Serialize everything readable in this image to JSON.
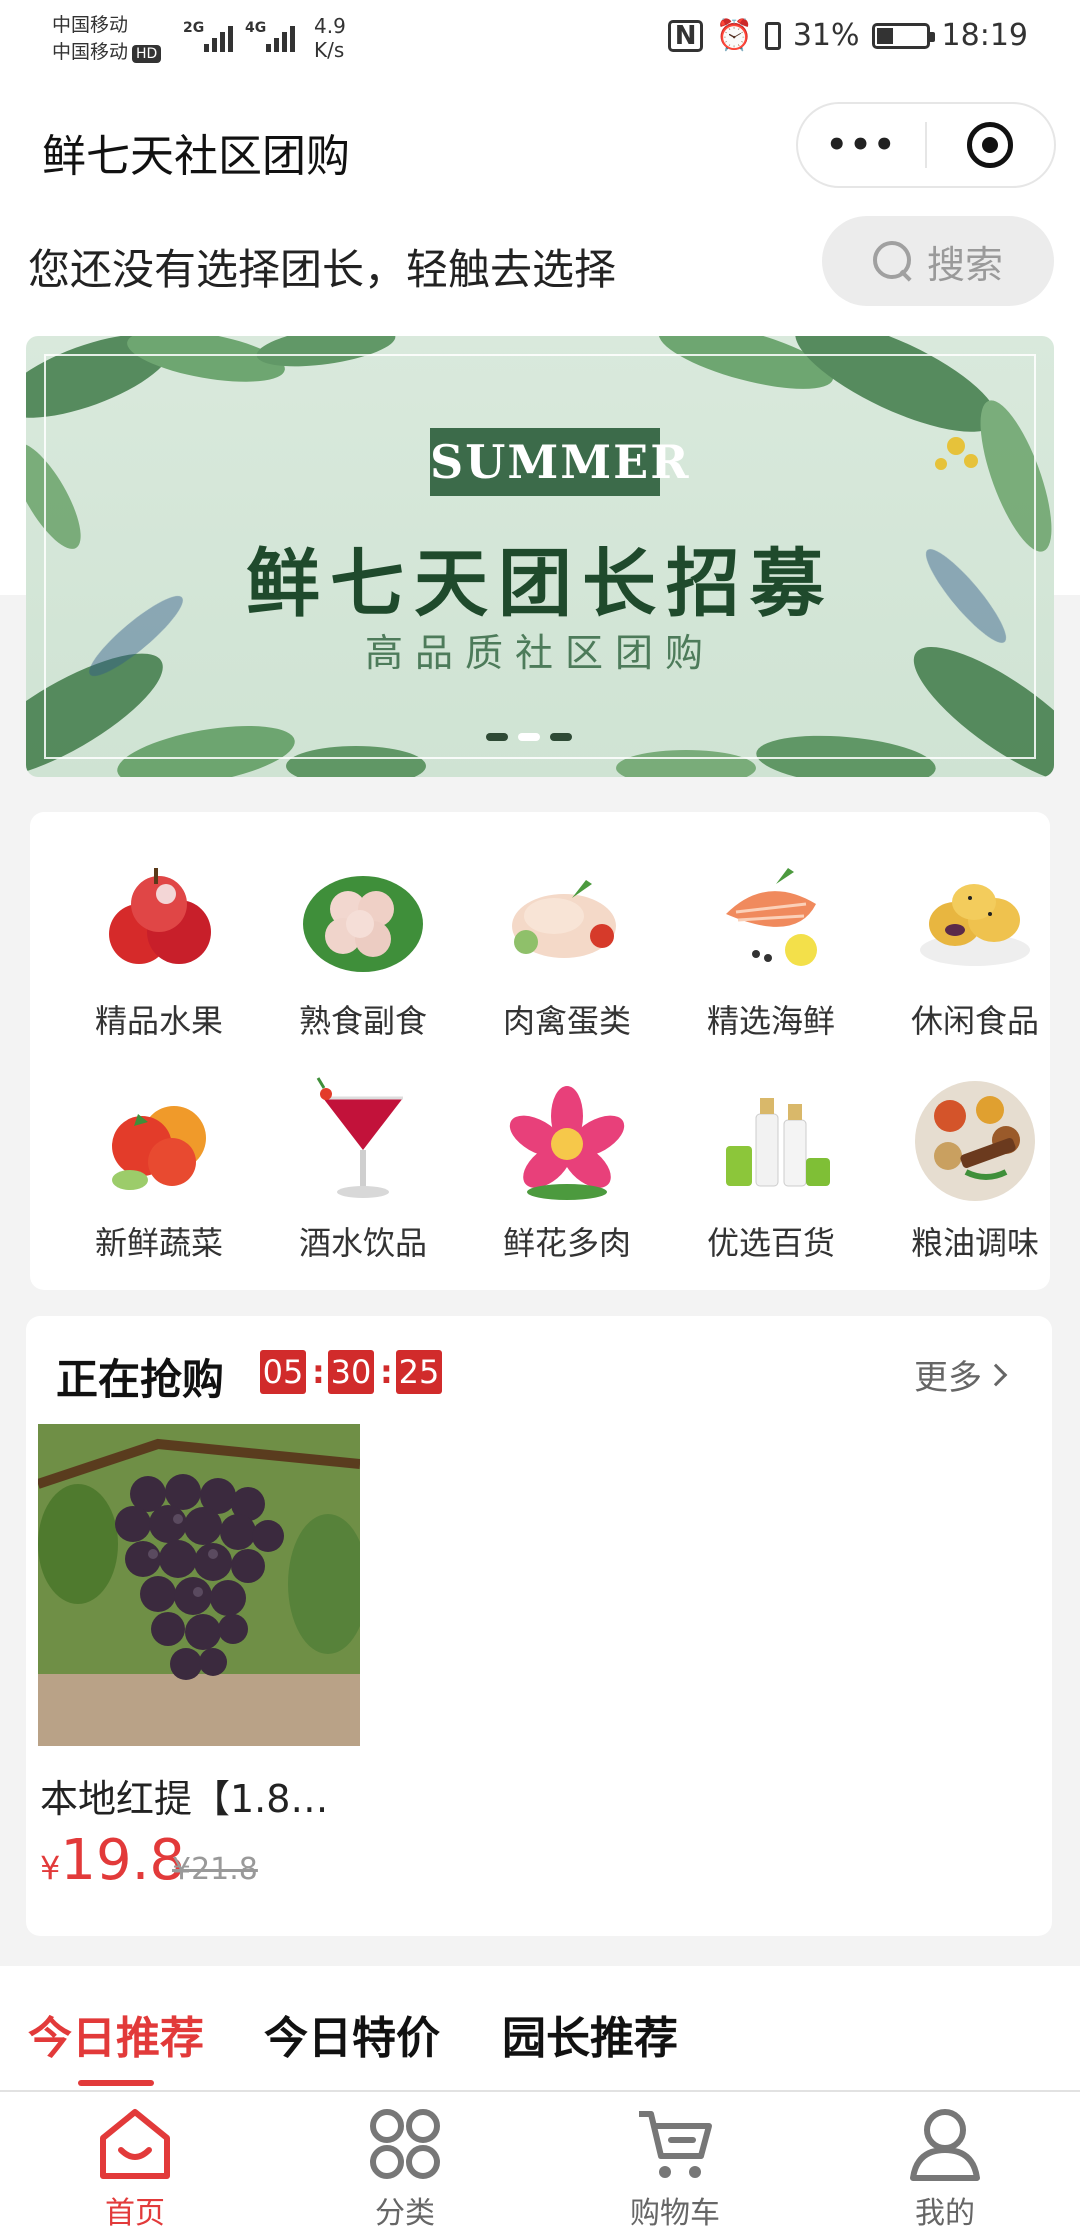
{
  "status_bar": {
    "carrier1": "中国移动",
    "carrier2": "中国移动",
    "hd": "HD",
    "net1": "2G",
    "net2": "4G",
    "speed_value": "4.9",
    "speed_unit": "K/s",
    "battery": "31%",
    "time": "18:19"
  },
  "header": {
    "title": "鲜七天社区团购",
    "more_label": "•••"
  },
  "leader_prompt": "您还没有选择团长，轻触去选择",
  "search": {
    "label": "搜索"
  },
  "banner": {
    "badge": "SUMMER",
    "headline": "鲜七天团长招募",
    "subline": "高品质社区团购",
    "active_dot": 1,
    "dot_count": 3
  },
  "categories": [
    {
      "label": "精品水果",
      "icon": "fruit-icon"
    },
    {
      "label": "熟食副食",
      "icon": "cooked-food-icon"
    },
    {
      "label": "肉禽蛋类",
      "icon": "poultry-icon"
    },
    {
      "label": "精选海鲜",
      "icon": "seafood-icon"
    },
    {
      "label": "休闲食品",
      "icon": "snack-icon"
    },
    {
      "label": "新鲜蔬菜",
      "icon": "vegetable-icon"
    },
    {
      "label": "酒水饮品",
      "icon": "cocktail-icon"
    },
    {
      "label": "鲜花多肉",
      "icon": "flower-icon"
    },
    {
      "label": "优选百货",
      "icon": "cosmetics-icon"
    },
    {
      "label": "粮油调味",
      "icon": "spice-icon"
    }
  ],
  "flash_sale": {
    "title": "正在抢购",
    "countdown": [
      "05",
      "30",
      "25"
    ],
    "separator": ":",
    "more": "更多",
    "product": {
      "name": "本地红提【1.8…",
      "currency": "¥",
      "price": "19.8",
      "old_price": "¥21.8"
    }
  },
  "tabs": [
    {
      "label": "今日推荐",
      "active": true
    },
    {
      "label": "今日特价",
      "active": false
    },
    {
      "label": "园长推荐",
      "active": false
    }
  ],
  "bottom_nav": [
    {
      "label": "首页",
      "icon": "home-icon",
      "active": true
    },
    {
      "label": "分类",
      "icon": "category-icon",
      "active": false
    },
    {
      "label": "购物车",
      "icon": "cart-icon",
      "active": false
    },
    {
      "label": "我的",
      "icon": "profile-icon",
      "active": false
    }
  ],
  "colors": {
    "accent": "#e23a3a",
    "countdown_bg": "#d12b2b",
    "banner_green": "#3c6b4a"
  }
}
